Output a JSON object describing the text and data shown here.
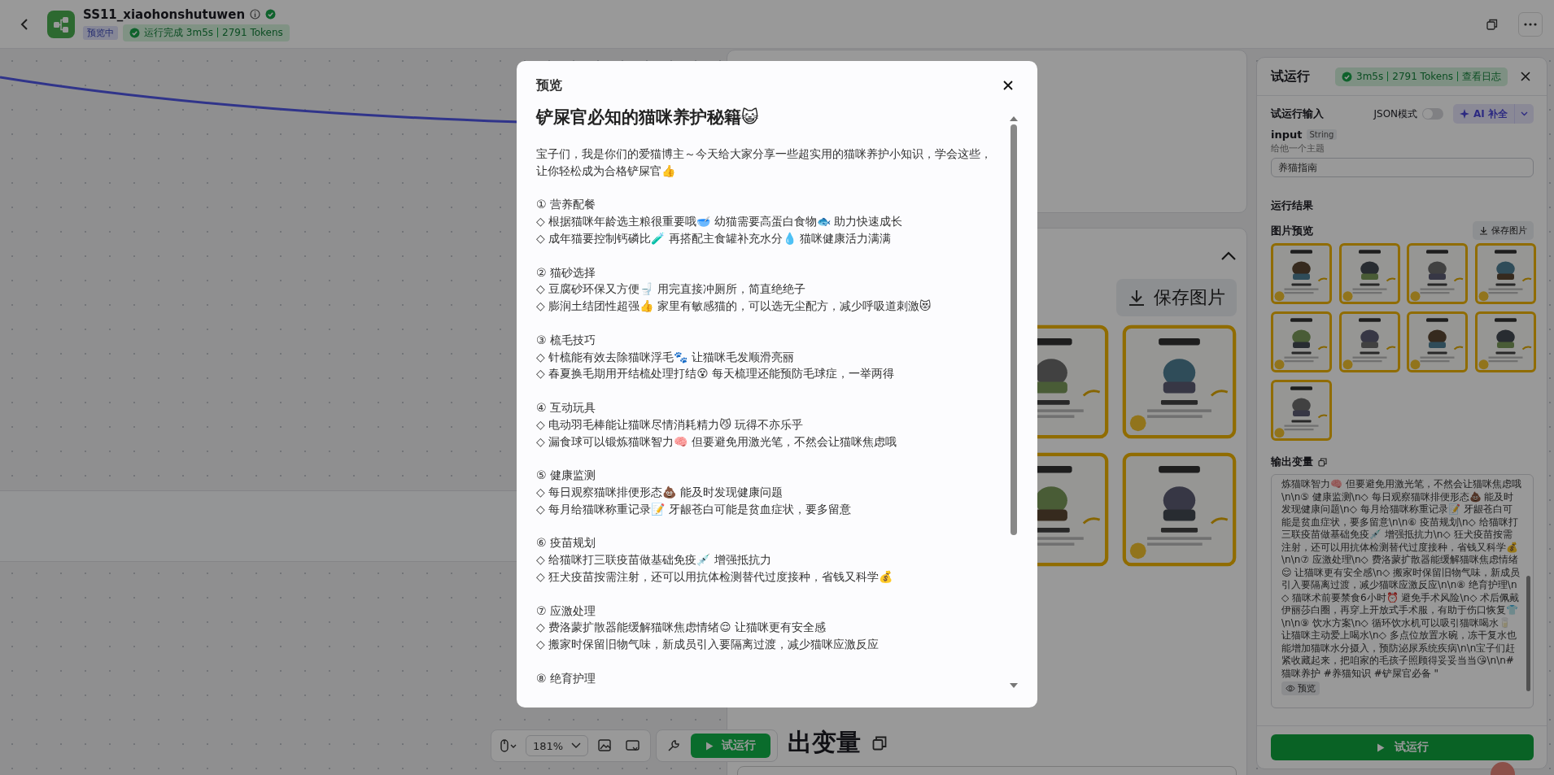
{
  "header": {
    "title": "SS11_xiaohonshutuwen",
    "badge": "预览中",
    "status": "运行完成 3m5s",
    "tokens": "2791 Tokens"
  },
  "canvas": {
    "save_button": "保存图片",
    "panel_heading": "出变量"
  },
  "toolbar": {
    "zoom": "181%",
    "run_button": "试运行"
  },
  "run_panel": {
    "title": "试运行",
    "duration": "3m5s",
    "tokens": "2791 Tokens",
    "log_link": "查看日志",
    "input_section": "试运行输入",
    "json_mode": {
      "label": "JSON模式",
      "on": false
    },
    "ai_button": "AI 补全",
    "field": {
      "name": "input",
      "type": "String",
      "description": "给他一个主题",
      "value": "养猫指南"
    },
    "results_title": "运行结果",
    "image_preview": {
      "title": "图片预览",
      "save_button": "保存图片"
    },
    "output": {
      "title": "输出变量",
      "text": "炼猫咪智力🧠 但要避免用激光笔，不然会让猫咪焦虑哦\\n\\n⑤ 健康监测\\n◇ 每日观察猫咪排便形态💩 能及时发现健康问题\\n◇ 每月给猫咪称重记录📝 牙龈苍白可能是贫血症状，要多留意\\n\\n⑥ 疫苗规划\\n◇ 给猫咪打三联疫苗做基础免疫💉 增强抵抗力\\n◇ 狂犬疫苗按需注射，还可以用抗体检测替代过度接种，省钱又科学💰\\n\\n⑦ 应激处理\\n◇ 费洛蒙扩散器能缓解猫咪焦虑情绪😌 让猫咪更有安全感\\n◇ 搬家时保留旧物气味，新成员引入要隔离过渡，减少猫咪应激反应\\n\\n⑧ 绝育护理\\n◇ 猫咪术前要禁食6小时⏰ 避免手术风险\\n◇ 术后佩戴伊丽莎白圈，再穿上开放式手术服，有助于伤口恢复👕 \\n\\n⑨ 饮水方案\\n◇ 循环饮水机可以吸引猫咪喝水🥛 让猫咪主动爱上喝水\\n◇ 多点位放置水碗，冻干复水也能增加猫咪水分摄入，预防泌尿系统疾病\\n\\n宝子们赶紧收藏起来，把咱家的毛孩子照顾得妥妥当当😘\\n\\n#猫咪养护 #养猫知识 #铲屎官必备 \"",
      "preview_button": "预览"
    },
    "run_button": "试运行"
  },
  "modal": {
    "title": "预览",
    "heading": "铲屎官必知的猫咪养护秘籍😺",
    "intro": "宝子们，我是你们的爱猫博主～今天给大家分享一些超实用的猫咪养护小知识，学会这些，让你轻松成为合格铲屎官👍",
    "sections": [
      {
        "title": "① 营养配餐",
        "lines": [
          "◇ 根据猫咪年龄选主粮很重要哦🥣 幼猫需要高蛋白食物🐟 助力快速成长",
          "◇ 成年猫要控制钙磷比🧪 再搭配主食罐补充水分💧 猫咪健康活力满满"
        ]
      },
      {
        "title": "② 猫砂选择",
        "lines": [
          "◇ 豆腐砂环保又方便🚽 用完直接冲厕所，简直绝绝子",
          "◇ 膨润土结团性超强👍 家里有敏感猫的，可以选无尘配方，减少呼吸道刺激😻"
        ]
      },
      {
        "title": "③ 梳毛技巧",
        "lines": [
          "◇ 针梳能有效去除猫咪浮毛🐾 让猫咪毛发顺滑亮丽",
          "◇ 春夏换毛期用开结梳处理打结😵 每天梳理还能预防毛球症，一举两得"
        ]
      },
      {
        "title": "④ 互动玩具",
        "lines": [
          "◇ 电动羽毛棒能让猫咪尽情消耗精力😼 玩得不亦乐乎",
          "◇ 漏食球可以锻炼猫咪智力🧠 但要避免用激光笔，不然会让猫咪焦虑哦"
        ]
      },
      {
        "title": "⑤ 健康监测",
        "lines": [
          "◇ 每日观察猫咪排便形态💩 能及时发现健康问题",
          "◇ 每月给猫咪称重记录📝 牙龈苍白可能是贫血症状，要多留意"
        ]
      },
      {
        "title": "⑥ 疫苗规划",
        "lines": [
          "◇ 给猫咪打三联疫苗做基础免疫💉 增强抵抗力",
          "◇ 狂犬疫苗按需注射，还可以用抗体检测替代过度接种，省钱又科学💰"
        ]
      },
      {
        "title": "⑦ 应激处理",
        "lines": [
          "◇ 费洛蒙扩散器能缓解猫咪焦虑情绪😌 让猫咪更有安全感",
          "◇ 搬家时保留旧物气味，新成员引入要隔离过渡，减少猫咪应激反应"
        ]
      },
      {
        "title": "⑧ 绝育护理"
      }
    ]
  }
}
